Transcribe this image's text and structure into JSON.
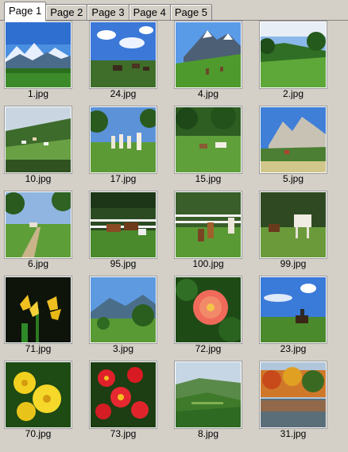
{
  "tabs": [
    {
      "label": "Page 1",
      "active": true
    },
    {
      "label": "Page 2",
      "active": false
    },
    {
      "label": "Page 3",
      "active": false
    },
    {
      "label": "Page 4",
      "active": false
    },
    {
      "label": "Page 5",
      "active": false
    }
  ],
  "thumbnails": [
    {
      "filename": "1.jpg",
      "scene": "mountain-lake"
    },
    {
      "filename": "24.jpg",
      "scene": "horses-sky"
    },
    {
      "filename": "4.jpg",
      "scene": "alpine-pasture"
    },
    {
      "filename": "2.jpg",
      "scene": "green-valley"
    },
    {
      "filename": "10.jpg",
      "scene": "hillside-village"
    },
    {
      "filename": "17.jpg",
      "scene": "garden-statues"
    },
    {
      "filename": "15.jpg",
      "scene": "meadow-horse"
    },
    {
      "filename": "5.jpg",
      "scene": "rocky-peak"
    },
    {
      "filename": "6.jpg",
      "scene": "country-road"
    },
    {
      "filename": "95.jpg",
      "scene": "horses-fence"
    },
    {
      "filename": "100.jpg",
      "scene": "horses-paddock"
    },
    {
      "filename": "99.jpg",
      "scene": "white-horse"
    },
    {
      "filename": "71.jpg",
      "scene": "yellow-lilies"
    },
    {
      "filename": "3.jpg",
      "scene": "valley-trees"
    },
    {
      "filename": "72.jpg",
      "scene": "pink-flower"
    },
    {
      "filename": "23.jpg",
      "scene": "rider-horse"
    },
    {
      "filename": "70.jpg",
      "scene": "yellow-flowers"
    },
    {
      "filename": "73.jpg",
      "scene": "red-flowers"
    },
    {
      "filename": "8.jpg",
      "scene": "rolling-hills"
    },
    {
      "filename": "31.jpg",
      "scene": "autumn-lake"
    }
  ]
}
